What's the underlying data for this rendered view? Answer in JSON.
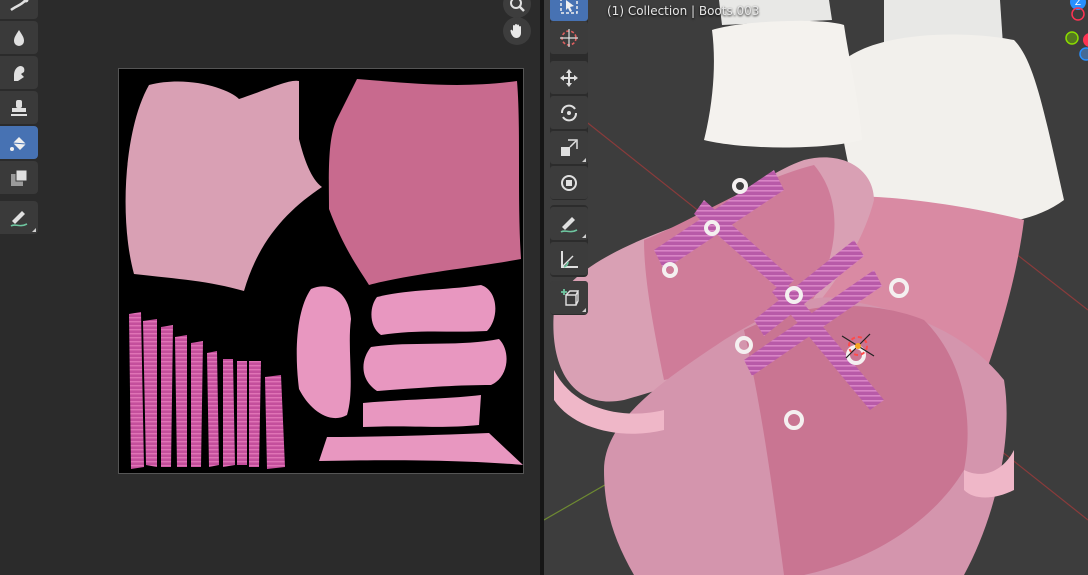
{
  "image_editor": {
    "tools": [
      {
        "name": "smear-icon",
        "active": false
      },
      {
        "name": "soften-icon",
        "active": false
      },
      {
        "name": "clone-icon",
        "active": false
      },
      {
        "name": "mask-stamp-icon",
        "active": false
      },
      {
        "name": "fill-icon",
        "active": true
      },
      {
        "name": "mask-icon",
        "active": false
      },
      {
        "name": "annotate-icon",
        "active": false
      }
    ],
    "navigation": [
      "zoom-icon",
      "pan-hand-icon"
    ],
    "texture_colors": {
      "background": "#000000",
      "boot_body": "#d9a0b4",
      "boot_toe": "#c86a8e",
      "lace": "#c44f9c",
      "pink_light": "#e897c0"
    }
  },
  "viewport": {
    "object_info": "(1) Collection | Boots.003",
    "tools": [
      "select-box-icon",
      "cursor-icon",
      "move-icon",
      "rotate-icon",
      "scale-icon",
      "transform-icon",
      "annotate-icon",
      "measure-icon",
      "add-cube-icon"
    ],
    "axis_colors": {
      "x": "#ff3352",
      "y": "#8bdc00",
      "z": "#2890ff"
    }
  }
}
